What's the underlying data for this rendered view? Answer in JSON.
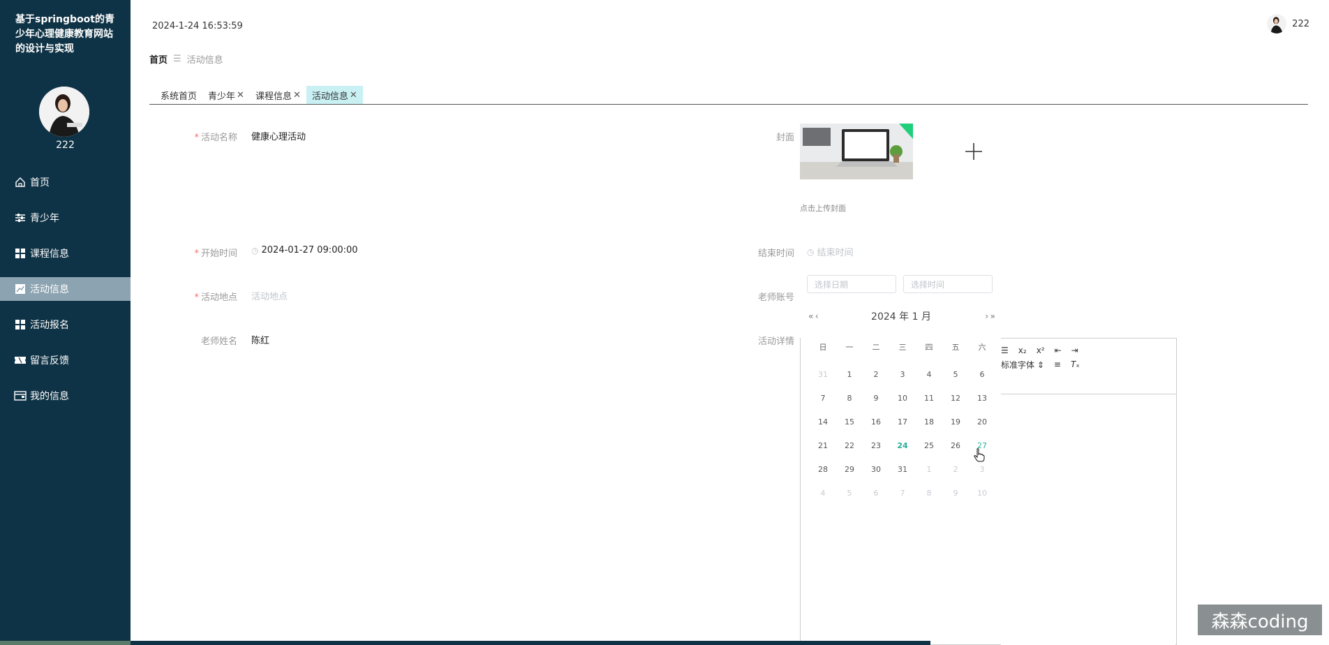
{
  "sidebar": {
    "title": "基于springboot的青少年心理健康教育网站的设计与实现",
    "username": "222",
    "items": [
      {
        "label": "首页",
        "icon": "home-icon"
      },
      {
        "label": "青少年",
        "icon": "sliders-icon"
      },
      {
        "label": "课程信息",
        "icon": "grid-icon"
      },
      {
        "label": "活动信息",
        "icon": "chart-icon"
      },
      {
        "label": "活动报名",
        "icon": "grid-icon"
      },
      {
        "label": "留言反馈",
        "icon": "ticket-icon"
      },
      {
        "label": "我的信息",
        "icon": "wallet-icon"
      }
    ]
  },
  "header": {
    "datetime": "2024-1-24 16:53:59",
    "username": "222"
  },
  "breadcrumb": {
    "home": "首页",
    "separator": "☰",
    "current": "活动信息"
  },
  "tabs": [
    {
      "label": "系统首页",
      "closable": false
    },
    {
      "label": "青少年",
      "closable": true
    },
    {
      "label": "课程信息",
      "closable": true
    },
    {
      "label": "活动信息",
      "closable": true
    }
  ],
  "form": {
    "name_label": "活动名称",
    "name_value": "健康心理活动",
    "cover_label": "封面",
    "cover_hint": "点击上传封面",
    "start_label": "开始时间",
    "start_value": "2024-01-27 09:00:00",
    "end_label": "结束时间",
    "end_placeholder": "结束时间",
    "location_label": "活动地点",
    "location_placeholder": "活动地点",
    "teacher_account_label": "老师账号",
    "teacher_name_label": "老师姓名",
    "teacher_name_value": "陈红",
    "details_label": "活动详情"
  },
  "picker": {
    "date_placeholder": "选择日期",
    "time_placeholder": "选择时间",
    "year_label": "2024 年",
    "month_label": "1 月",
    "prev_year": "«",
    "prev_month": "‹",
    "next_month": "›",
    "next_year": "»",
    "weekdays": [
      "日",
      "一",
      "二",
      "三",
      "四",
      "五",
      "六"
    ],
    "weeks": [
      [
        {
          "d": "31",
          "m": 1
        },
        {
          "d": "1"
        },
        {
          "d": "2"
        },
        {
          "d": "3"
        },
        {
          "d": "4"
        },
        {
          "d": "5"
        },
        {
          "d": "6"
        }
      ],
      [
        {
          "d": "7"
        },
        {
          "d": "8"
        },
        {
          "d": "9"
        },
        {
          "d": "10"
        },
        {
          "d": "11"
        },
        {
          "d": "12"
        },
        {
          "d": "13"
        }
      ],
      [
        {
          "d": "14"
        },
        {
          "d": "15"
        },
        {
          "d": "16"
        },
        {
          "d": "17"
        },
        {
          "d": "18"
        },
        {
          "d": "19"
        },
        {
          "d": "20"
        }
      ],
      [
        {
          "d": "21"
        },
        {
          "d": "22"
        },
        {
          "d": "23"
        },
        {
          "d": "24",
          "t": 1
        },
        {
          "d": "25"
        },
        {
          "d": "26"
        },
        {
          "d": "27",
          "h": 1
        }
      ],
      [
        {
          "d": "28"
        },
        {
          "d": "29"
        },
        {
          "d": "30"
        },
        {
          "d": "31"
        },
        {
          "d": "1",
          "m": 1
        },
        {
          "d": "2",
          "m": 1
        },
        {
          "d": "3",
          "m": 1
        }
      ],
      [
        {
          "d": "4",
          "m": 1
        },
        {
          "d": "5",
          "m": 1
        },
        {
          "d": "6",
          "m": 1
        },
        {
          "d": "7",
          "m": 1
        },
        {
          "d": "8",
          "m": 1
        },
        {
          "d": "9",
          "m": 1
        },
        {
          "d": "10",
          "m": 1
        }
      ]
    ]
  },
  "editor": {
    "font_label": "标准字体"
  },
  "watermark": "森森coding",
  "colors": {
    "sidebar_bg": "#0f3346",
    "active_menu": "#8ca3b1",
    "active_tab": "#c9f1f4",
    "accent": "#27b099"
  }
}
